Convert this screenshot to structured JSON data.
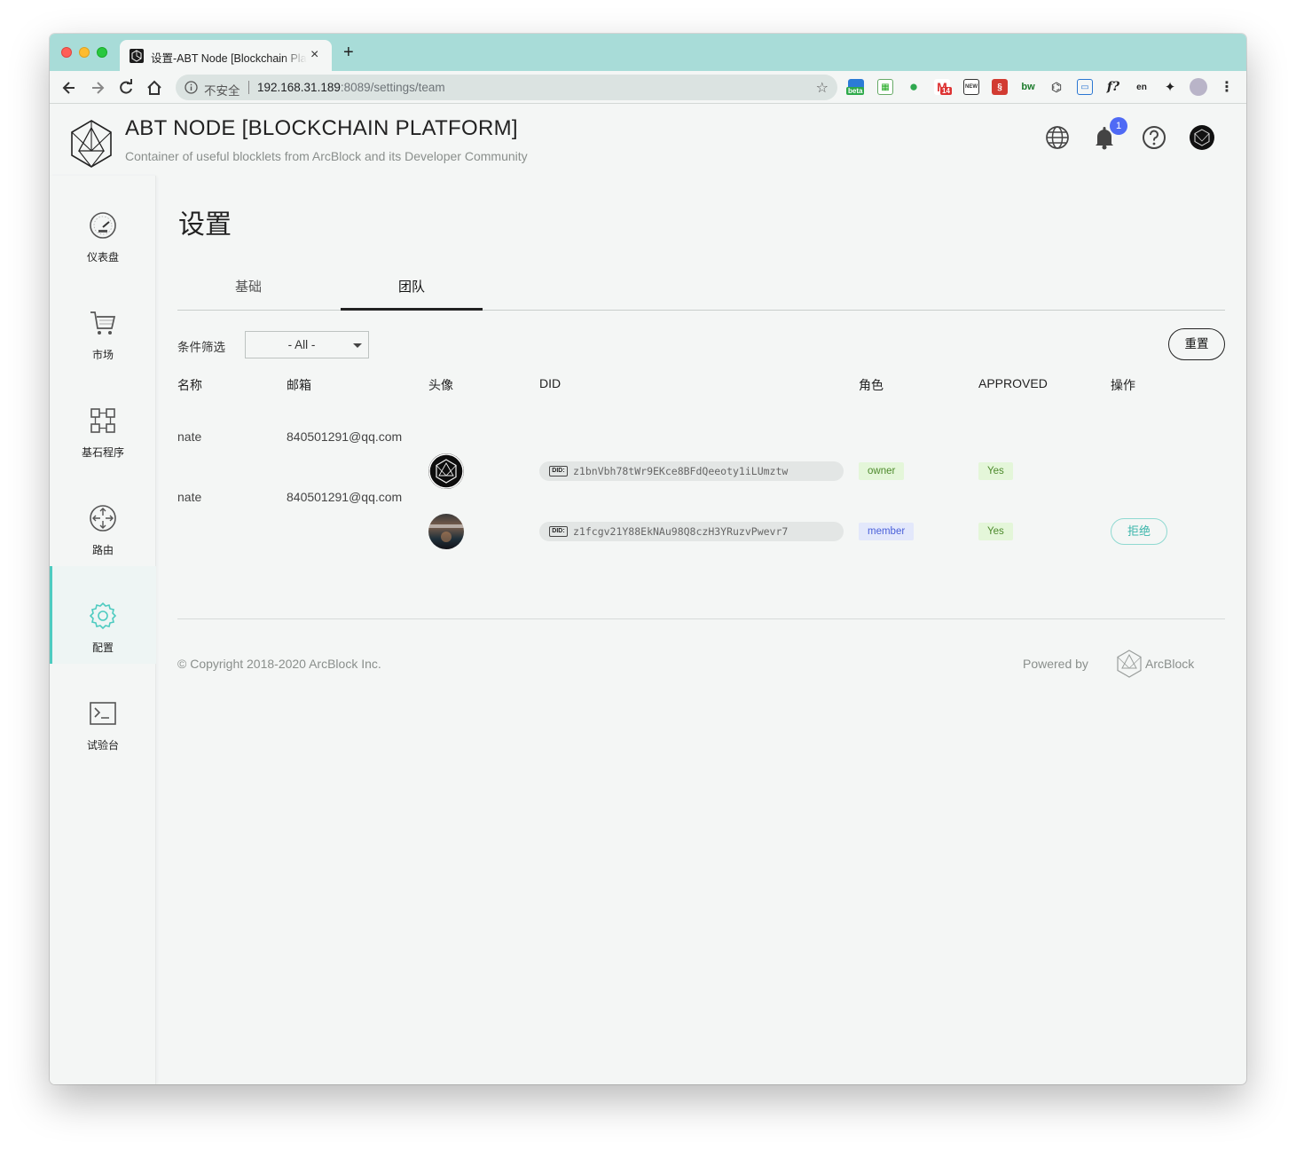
{
  "browser": {
    "tab_title": "设置-ABT Node [Blockchain Platform]",
    "insecure_label": "不安全",
    "url_host": "192.168.31.189",
    "url_rest": ":8089/settings/team",
    "extensions": [
      "beta-ext",
      "sheets-ext",
      "evernote-ext",
      "gmail-ext",
      "news-ext",
      "ext-red",
      "bw-ext",
      "ext-mono",
      "cast-ext",
      "formula-ext",
      "translate-ext",
      "puzzle-ext",
      "profile-avatar"
    ],
    "gmail_count": "14",
    "beta_label": "beta",
    "colors": {
      "tabstrip": "#a8dcd8",
      "accent": "#4ecbc0"
    }
  },
  "header": {
    "title": "ABT NODE [BLOCKCHAIN PLATFORM]",
    "subtitle": "Container of useful blocklets from ArcBlock and its Developer Community",
    "notification_count": "1",
    "icons": [
      "globe-icon",
      "bell-icon",
      "help-icon",
      "account-avatar"
    ]
  },
  "sidebar": {
    "items": [
      {
        "label": "仪表盘",
        "icon": "dashboard-icon",
        "active": false
      },
      {
        "label": "市场",
        "icon": "cart-icon",
        "active": false
      },
      {
        "label": "基石程序",
        "icon": "blocklets-icon",
        "active": false
      },
      {
        "label": "路由",
        "icon": "router-icon",
        "active": false
      },
      {
        "label": "配置",
        "icon": "gear-icon",
        "active": true
      },
      {
        "label": "试验台",
        "icon": "terminal-icon",
        "active": false
      }
    ]
  },
  "page": {
    "title": "设置",
    "tabs": [
      {
        "label": "基础",
        "active": false
      },
      {
        "label": "团队",
        "active": true
      }
    ],
    "filter_label": "条件筛选",
    "filter_value": "- All -",
    "reset_label": "重置"
  },
  "table": {
    "columns": [
      "名称",
      "邮箱",
      "头像",
      "DID",
      "角色",
      "APPROVED",
      "操作"
    ],
    "rows": [
      {
        "name": "nate",
        "email": "840501291@qq.com",
        "did": "z1bnVbh78tWr9EKce8BFdQeeoty1iLUmztw",
        "role": "owner",
        "approved": "Yes",
        "action": ""
      },
      {
        "name": "nate",
        "email": "840501291@qq.com",
        "did": "z1fcgv21Y88EkNAu98Q8czH3YRuzvPwevr7",
        "role": "member",
        "approved": "Yes",
        "action": "拒绝"
      }
    ],
    "did_tag": "DID:"
  },
  "footer": {
    "copyright": "© Copyright 2018-2020  ArcBlock Inc.",
    "powered_by": "Powered by",
    "brand": "ArcBlock"
  }
}
